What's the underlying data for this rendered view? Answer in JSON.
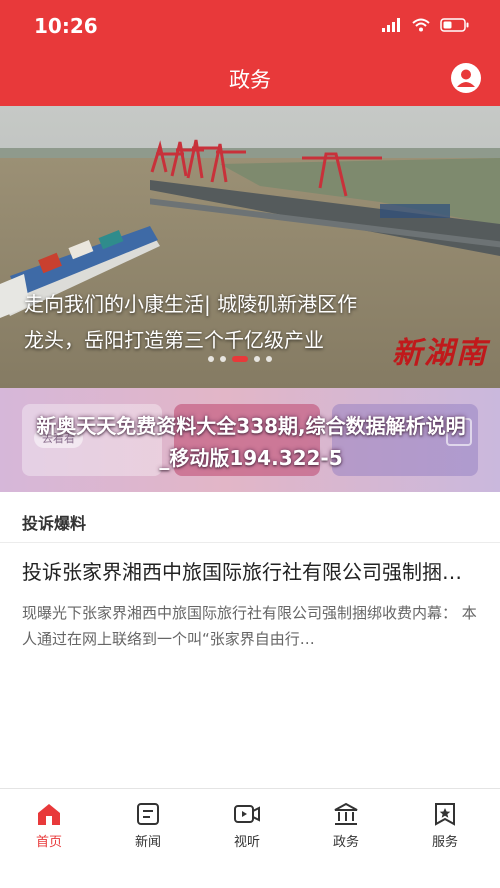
{
  "status_bar": {
    "time": "10:26"
  },
  "header": {
    "title": "政务"
  },
  "banner": {
    "caption": "走向我们的小康生活| 城陵矶新港区作龙头，岳阳打造第三个千亿级产业",
    "stamp_text": "新湖南",
    "slide_count": 5,
    "active_slide": 3
  },
  "overlay": {
    "headline": "新奥天天免费资料大全338期,综合数据解析说明_移动版194.322-5",
    "ghost_button": "去看看"
  },
  "section": {
    "title": "投诉爆料",
    "item_title": "投诉张家界湘西中旅国际旅行社有限公司强制捆绑收费",
    "item_summary": "现曝光下张家界湘西中旅国际旅行社有限公司强制捆绑收费内幕：   本人通过在网上联络到一个叫“张家界自由行…"
  },
  "tabbar": {
    "items": [
      {
        "label": "首页",
        "icon": "home-icon",
        "active": true
      },
      {
        "label": "新闻",
        "icon": "news-icon",
        "active": false
      },
      {
        "label": "视听",
        "icon": "video-icon",
        "active": false
      },
      {
        "label": "政务",
        "icon": "government-icon",
        "active": false
      },
      {
        "label": "服务",
        "icon": "service-icon",
        "active": false
      }
    ]
  },
  "colors": {
    "brand_red": "#e8393a",
    "tab_active": "#e8393a"
  }
}
